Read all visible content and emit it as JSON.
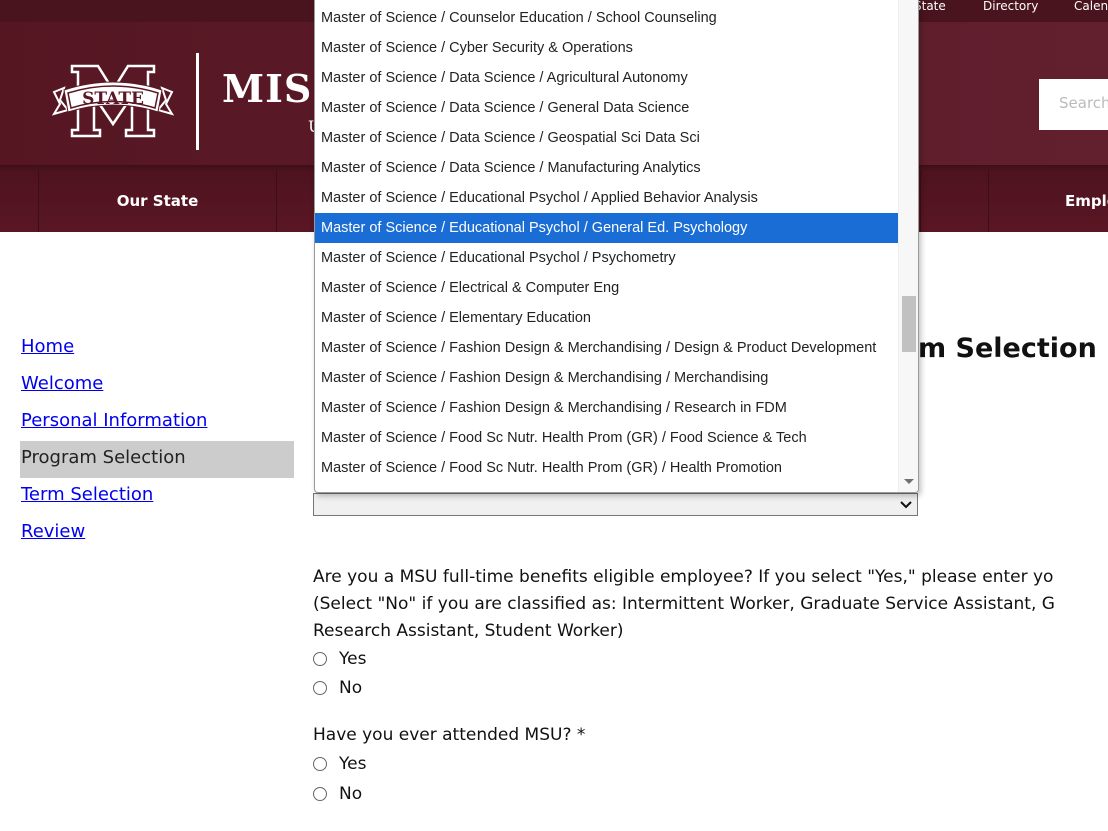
{
  "header": {
    "top_links": [
      "State",
      "Directory",
      "Calendar"
    ],
    "logo_text": "MISSISSIPPI STATE",
    "logo_sub": "UNIVERSITY",
    "search_placeholder": "Search",
    "nav": [
      "Our State",
      "Employment"
    ]
  },
  "sidebar": {
    "items": [
      {
        "label": "Home",
        "active": false
      },
      {
        "label": "Welcome",
        "active": false
      },
      {
        "label": "Personal Information",
        "active": false
      },
      {
        "label": "Program Selection",
        "active": true
      },
      {
        "label": "Term Selection",
        "active": false
      },
      {
        "label": "Review",
        "active": false
      }
    ]
  },
  "main": {
    "title": "Program Selection",
    "title_visible": "m Selection",
    "program_select_value": "",
    "question1": {
      "lines": [
        "Are you a MSU full-time benefits eligible employee? If you select \"Yes,\" please enter yo",
        "(Select \"No\" if you are classified as: Intermittent Worker, Graduate Service Assistant, G",
        "Research Assistant, Student Worker)"
      ],
      "options": [
        "Yes",
        "No"
      ]
    },
    "question2": {
      "label": "Have you ever attended MSU? *",
      "options": [
        "Yes",
        "No"
      ]
    }
  },
  "dropdown": {
    "selected_index": 7,
    "scroll_position": 0.6,
    "options": [
      "Master of Science / Counselor Education / School Counseling",
      "Master of Science / Cyber Security & Operations",
      "Master of Science / Data Science / Agricultural Autonomy",
      "Master of Science / Data Science / General Data Science",
      "Master of Science / Data Science / Geospatial Sci Data Sci",
      "Master of Science / Data Science / Manufacturing Analytics",
      "Master of Science / Educational Psychol / Applied Behavior Analysis",
      "Master of Science / Educational Psychol / General Ed. Psychology",
      "Master of Science / Educational Psychol / Psychometry",
      "Master of Science / Electrical & Computer Eng",
      "Master of Science / Elementary Education",
      "Master of Science / Fashion Design & Merchandising / Design & Product Development",
      "Master of Science / Fashion Design & Merchandising / Merchandising",
      "Master of Science / Fashion Design & Merchandising / Research in FDM",
      "Master of Science / Food Sc Nutr. Health Prom (GR) / Food Science & Tech",
      "Master of Science / Food Sc Nutr. Health Prom (GR) / Health Promotion"
    ]
  },
  "colors": {
    "maroon": "#5d1b2a",
    "highlight": "#1a6dd4",
    "link": "#0000ee",
    "active_bg": "#cccccc"
  }
}
